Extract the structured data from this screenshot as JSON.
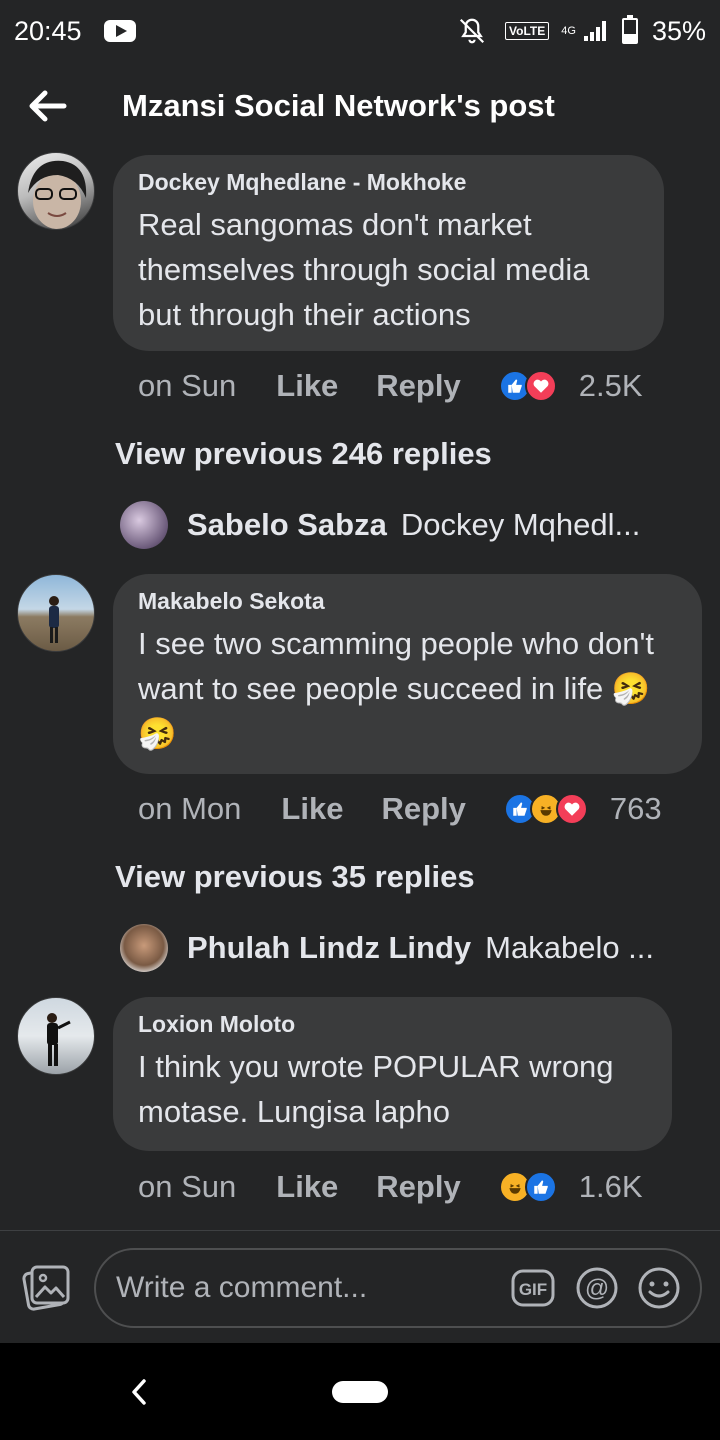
{
  "status_bar": {
    "time": "20:45",
    "network_badge": "VoLTE",
    "network_type": "4G",
    "battery": "35%"
  },
  "header": {
    "title": "Mzansi Social Network's post"
  },
  "comments": [
    {
      "author": "Dockey Mqhedlane - Mokhoke",
      "text": "Real sangomas don't market themselves through social media but through their actions",
      "time": "on Sun",
      "like_label": "Like",
      "reply_label": "Reply",
      "reactions": [
        "like",
        "love"
      ],
      "reaction_count": "2.5K",
      "view_previous": "View previous 246 replies",
      "reply_preview": {
        "name": "Sabelo Sabza",
        "snippet": "Dockey Mqhedl..."
      }
    },
    {
      "author": "Makabelo Sekota",
      "text": "I see two scamming people who don't want to see people succeed in life 🤧🤧",
      "time": "on Mon",
      "like_label": "Like",
      "reply_label": "Reply",
      "reactions": [
        "like",
        "haha",
        "love"
      ],
      "reaction_count": "763",
      "view_previous": "View previous 35 replies",
      "reply_preview": {
        "name": "Phulah Lindz Lindy",
        "snippet": "Makabelo ..."
      }
    },
    {
      "author": "Loxion Moloto",
      "text": "I think you wrote POPULAR wrong motase. Lungisa lapho",
      "time": "on Sun",
      "like_label": "Like",
      "reply_label": "Reply",
      "reactions": [
        "haha",
        "like"
      ],
      "reaction_count": "1.6K"
    }
  ],
  "composer": {
    "placeholder": "Write a comment...",
    "gif_label": "GIF",
    "mention_label": "@"
  },
  "colors": {
    "background": "#242526",
    "bubble": "#3a3b3c",
    "like_blue": "#1b74e4",
    "love_red": "#f33e58",
    "haha_yellow": "#f7b125"
  }
}
